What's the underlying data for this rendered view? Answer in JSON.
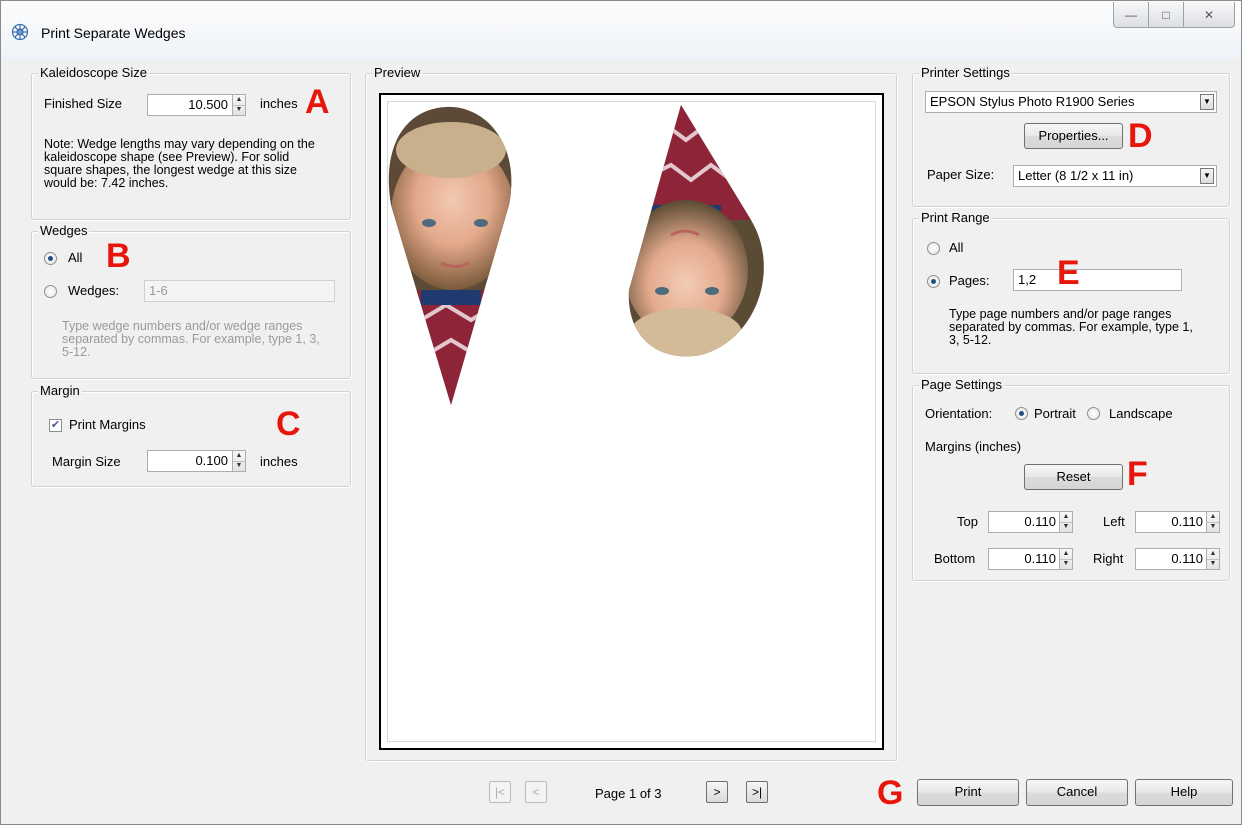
{
  "window": {
    "title": "Print Separate Wedges",
    "controls": {
      "minimize": "—",
      "maximize": "□",
      "close": "✕"
    }
  },
  "kaleidoscope": {
    "legend": "Kaleidoscope Size",
    "finished_size_label": "Finished Size",
    "finished_size_value": "10.500",
    "unit": "inches",
    "note": "Note: Wedge lengths may vary depending on the kaleidoscope shape (see Preview). For solid square shapes, the longest wedge at this size would be: 7.42 inches."
  },
  "wedges": {
    "legend": "Wedges",
    "all_label": "All",
    "wedges_label": "Wedges:",
    "wedges_value": "1-6",
    "hint": "Type wedge numbers and/or wedge ranges separated by commas.  For example, type 1, 3, 5-12."
  },
  "margin": {
    "legend": "Margin",
    "print_margins_label": "Print Margins",
    "print_margins_checked": true,
    "margin_size_label": "Margin Size",
    "margin_size_value": "0.100",
    "unit": "inches"
  },
  "preview": {
    "legend": "Preview",
    "page_text": "Page 1 of 3",
    "nav": {
      "first": "|<",
      "prev": "<",
      "next": ">",
      "last": ">|"
    }
  },
  "printer": {
    "legend": "Printer Settings",
    "printer_name": "EPSON Stylus Photo R1900 Series",
    "properties_label": "Properties...",
    "paper_size_label": "Paper Size:",
    "paper_size_value": "Letter (8 1/2 x 11 in)"
  },
  "print_range": {
    "legend": "Print Range",
    "all_label": "All",
    "pages_label": "Pages:",
    "pages_value": "1,2",
    "hint": "Type page numbers and/or page ranges separated by commas.  For example, type 1, 3, 5-12."
  },
  "page_settings": {
    "legend": "Page Settings",
    "orientation_label": "Orientation:",
    "portrait_label": "Portrait",
    "landscape_label": "Landscape",
    "margins_label": "Margins (inches)",
    "reset_label": "Reset",
    "top_label": "Top",
    "top_value": "0.110",
    "left_label": "Left",
    "left_value": "0.110",
    "bottom_label": "Bottom",
    "bottom_value": "0.110",
    "right_label": "Right",
    "right_value": "0.110"
  },
  "footer": {
    "print_label": "Print",
    "cancel_label": "Cancel",
    "help_label": "Help"
  },
  "annotations": {
    "a": "A",
    "b": "B",
    "c": "C",
    "d": "D",
    "e": "E",
    "f": "F",
    "g": "G",
    "color": "#e8150b"
  }
}
